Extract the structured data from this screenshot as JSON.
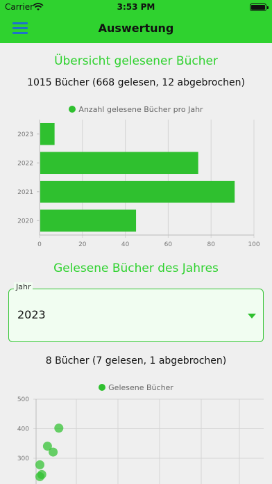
{
  "status": {
    "carrier": "Carrier",
    "time": "3:53 PM"
  },
  "header": {
    "title": "Auswertung"
  },
  "overview": {
    "title": "Übersicht gelesener Bücher",
    "summary": "1015 Bücher (668 gelesen, 12 abgebrochen)"
  },
  "year_section": {
    "title": "Gelesene Bücher des Jahres",
    "dropdown_label": "Jahr",
    "dropdown_value": "2023",
    "summary": "8 Bücher (7 gelesen, 1 abgebrochen)"
  },
  "colors": {
    "accent": "#2fd22f",
    "bar": "#2fc02f",
    "dropdown_arrow": "#2fc02f",
    "menu_icon": "#1e73c8"
  },
  "chart_data": [
    {
      "type": "bar",
      "orientation": "horizontal",
      "legend": "Anzahl gelesene Bücher pro Jahr",
      "legend_position": "top",
      "categories": [
        "2023",
        "2022",
        "2021",
        "2020"
      ],
      "values": [
        7,
        74,
        91,
        45
      ],
      "xticks": [
        "0",
        "20",
        "40",
        "60",
        "80",
        "100"
      ],
      "xlim": [
        0,
        100
      ],
      "grid": true
    },
    {
      "type": "scatter",
      "legend": "Gelesene Bücher",
      "legend_position": "top",
      "yticks": [
        "500",
        "400",
        "300"
      ],
      "ylim": [
        200,
        500
      ],
      "xlim": [
        0,
        12
      ],
      "points": [
        {
          "x": 1.2,
          "y": 402
        },
        {
          "x": 0.6,
          "y": 341
        },
        {
          "x": 0.9,
          "y": 321
        },
        {
          "x": 0.2,
          "y": 278
        },
        {
          "x": 0.3,
          "y": 245
        },
        {
          "x": 0.2,
          "y": 238
        }
      ],
      "grid": true
    }
  ]
}
